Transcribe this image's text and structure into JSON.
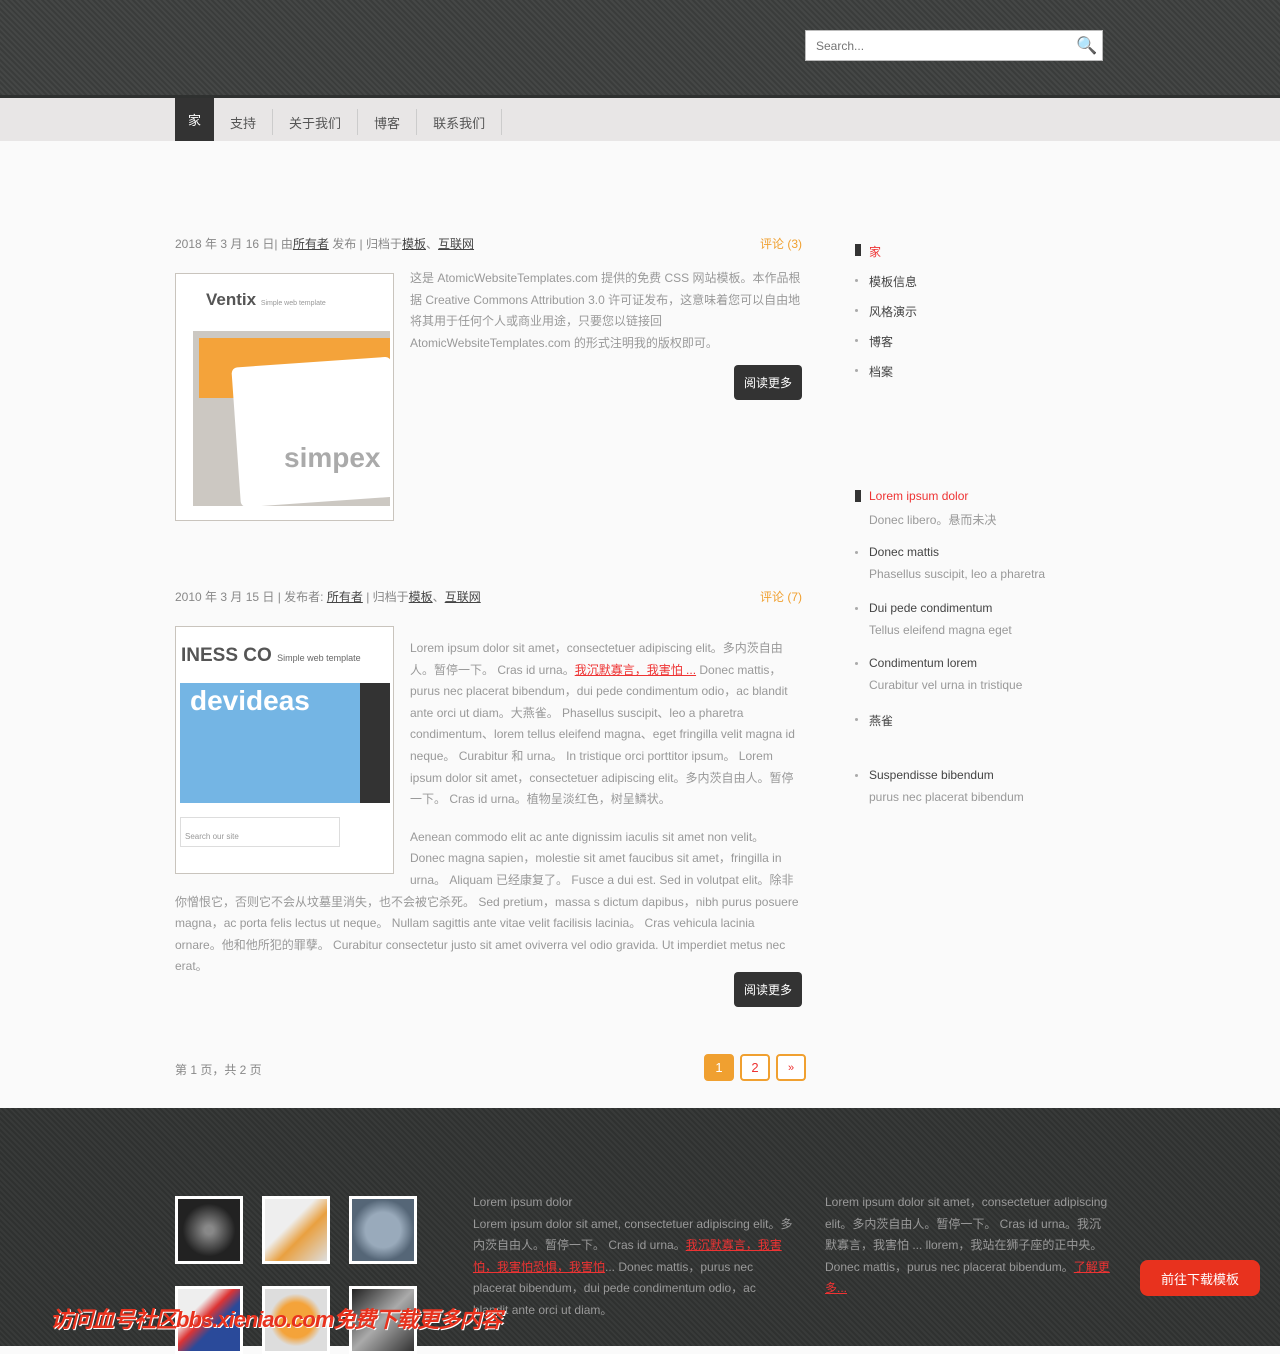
{
  "search": {
    "placeholder": "Search..."
  },
  "nav": [
    "家",
    "支持",
    "关于我们",
    "博客",
    "联系我们"
  ],
  "posts": [
    {
      "date": "2018 年 3 月 16 日| 由",
      "author": "所有者",
      "posted": " 发布 | 归档于",
      "cat1": "模板",
      "sep": "、",
      "cat2": "互联网",
      "comments": "评论 (3)",
      "thumb_brand": "Ventix",
      "thumb_tag": "Simple web template",
      "thumb_logo": "simpex",
      "body": "这是 AtomicWebsiteTemplates.com 提供的免费 CSS 网站模板。本作品根据 Creative Commons Attribution 3.0 许可证发布，这意味着您可以自由地将其用于任何个人或商业用途，只要您以链接回 AtomicWebsiteTemplates.com 的形式注明我的版权即可。",
      "more": "阅读更多"
    },
    {
      "date": "2010 年 3 月 15 日 | 发布者: ",
      "author": "所有者",
      "posted": " | 归档于",
      "cat1": "模板",
      "sep": "、",
      "cat2": "互联网",
      "comments": "评论 (7)",
      "thumb_brand": "INESS CO",
      "thumb_tag": "Simple web template",
      "thumb_logo": "devideas",
      "thumb_search": "Search our site",
      "body1a": "Lorem ipsum dolor sit amet，consectetuer adipiscing elit。多内茨自由人。暂停一下。 Cras id urna。",
      "body1link": "我沉默寡言，我害怕 ...",
      "body1b": " Donec mattis，purus nec placerat bibendum，dui pede condimentum odio，ac blandit ante orci ut diam。大燕雀。 Phasellus suscipit、leo a pharetra condimentum、lorem tellus eleifend magna、eget fringilla velit magna id neque。 Curabitur 和 urna。 In tristique orci porttitor ipsum。 Lorem ipsum dolor sit amet，consectetuer adipiscing elit。多内茨自由人。暂停一下。 Cras id urna。植物呈淡红色，树呈鳞状。",
      "body2": "Aenean commodo elit ac ante dignissim iaculis sit amet non velit。 Donec magna sapien，molestie sit amet faucibus sit amet，fringilla in urna。 Aliquam 已经康复了。 Fusce a dui est. Sed in volutpat elit。除非你憎恨它，否则它不会从坟墓里消失，也不会被它杀死。 Sed pretium，massa s dictum dapibus，nibh purus posuere magna，ac porta felis lectus ut neque。 Nullam sagittis ante vitae velit facilisis lacinia。 Cras vehicula lacinia ornare。他和他所犯的罪孽。 Curabitur consectetur justo sit amet oviverra vel odio gravida. Ut imperdiet metus nec erat。",
      "more": "阅读更多"
    }
  ],
  "pagination": {
    "label": "第 1 页，共 2 页",
    "pages": [
      "1",
      "2",
      "»"
    ],
    "current": "1"
  },
  "sidebar": {
    "menu": [
      "家",
      "模板信息",
      "风格演示",
      "博客",
      "档案"
    ],
    "news": [
      {
        "title": "Lorem ipsum dolor",
        "sub": "Donec libero。悬而未决"
      },
      {
        "title": "Donec mattis",
        "sub": "Phasellus suscipit, leo a pharetra"
      },
      {
        "title": "Dui pede condimentum",
        "sub": "Tellus eleifend magna eget"
      },
      {
        "title": "Condimentum lorem",
        "sub": "Curabitur vel urna in tristique"
      },
      {
        "title": "燕雀",
        "sub": ""
      },
      {
        "title": "Suspendisse bibendum",
        "sub": "purus nec placerat bibendum"
      }
    ]
  },
  "footer": {
    "col1_title": "Lorem ipsum dolor",
    "col1_a": "Lorem ipsum dolor sit amet, consectetuer adipiscing elit。多内茨自由人。暂停一下。 Cras id urna。",
    "col1_link": "我沉默寡言，我害怕，我害怕恐惧，我害怕",
    "col1_b": "... Donec mattis，purus nec placerat bibendum，dui pede condimentum odio，ac blandit ante orci ut diam。",
    "col2_a": "Lorem ipsum dolor sit amet，consectetuer adipiscing elit。多内茨自由人。暂停一下。 Cras id urna。我沉默寡言，我害怕 ... llorem，我站在狮子座的正中央。 Donec mattis，purus nec placerat bibendum。",
    "col2_link": "了解更多..."
  },
  "download_button": "前往下载模板",
  "watermark": "访问血号社区bbs.xieniao.com免费下载更多内容",
  "colors": {
    "accent": "#f0a030",
    "link_red": "#e33333",
    "dark": "#333333"
  }
}
